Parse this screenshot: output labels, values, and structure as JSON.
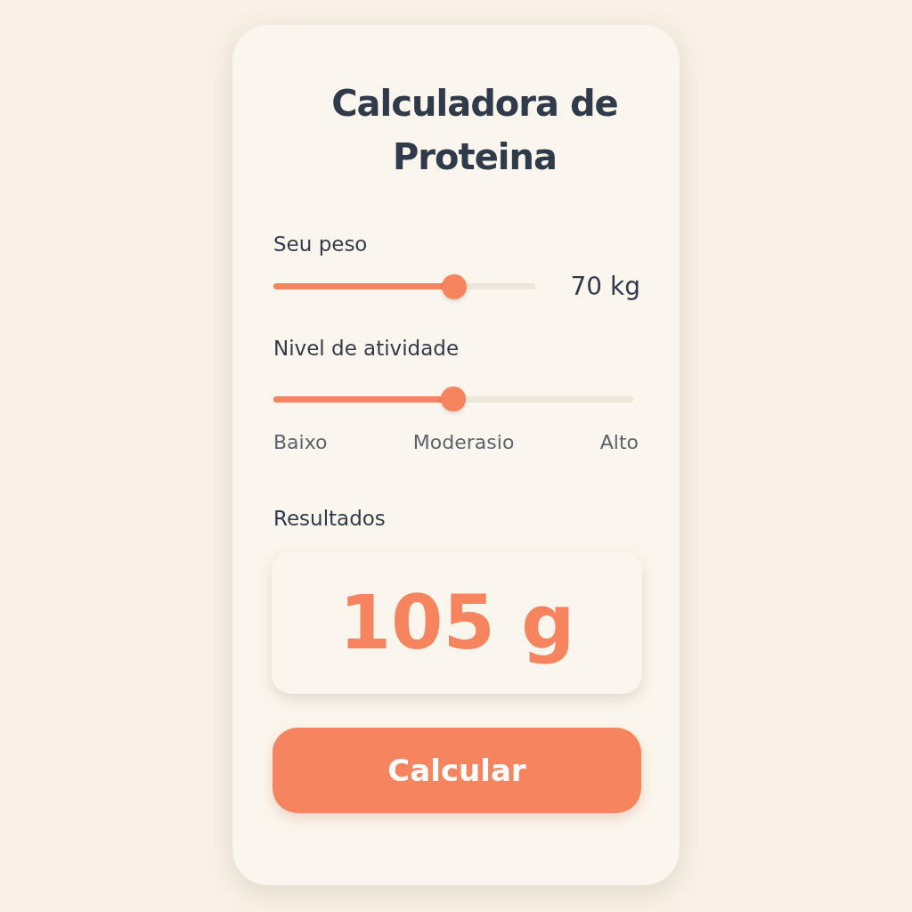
{
  "title": "Calculadora de Proteina",
  "weight": {
    "label": "Seu peso",
    "level": 0.69,
    "reading": "70 kg"
  },
  "activity": {
    "label": "Nivel de atividade",
    "level": 0.5,
    "scale_labels": [
      "Baixo",
      "Moderasio",
      "Alto"
    ]
  },
  "results": {
    "label": "Resultados",
    "value": "105 g"
  },
  "button": {
    "label": "Calcular"
  }
}
